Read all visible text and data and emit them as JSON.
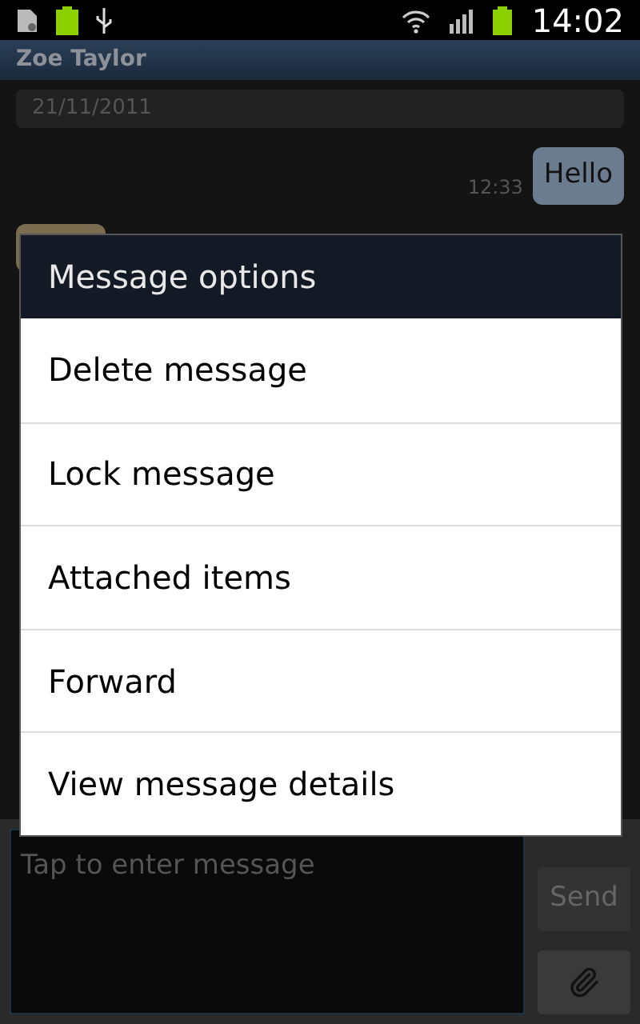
{
  "status_bar": {
    "time": "14:02"
  },
  "header": {
    "title": "Zoe Taylor"
  },
  "conversation": {
    "date": "21/11/2011",
    "messages": [
      {
        "kind": "sent",
        "text": "Hello",
        "time": "12:33"
      },
      {
        "kind": "received"
      }
    ]
  },
  "dialog": {
    "title": "Message options",
    "items": [
      "Delete message",
      "Lock message",
      "Attached items",
      "Forward",
      "View message details"
    ]
  },
  "composer": {
    "placeholder": "Tap to enter message",
    "send": "Send"
  }
}
